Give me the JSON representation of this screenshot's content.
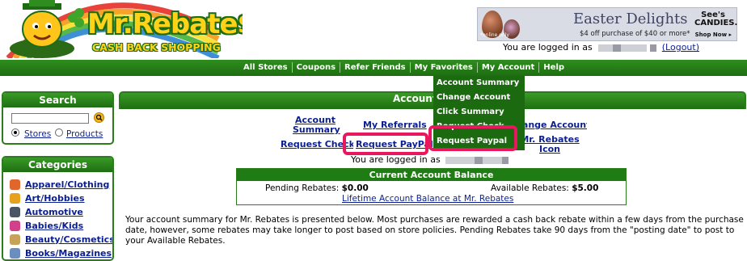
{
  "logo": {
    "title": "Mr.Rebate$",
    "subtitle": "CASH BACK SHOPPING"
  },
  "ad": {
    "headline": "Easter Delights",
    "offer": "$4 off purchase of $40 or more*",
    "fine_print": "*online only",
    "brand": "See's CANDIES.",
    "cta": "Shop Now ▸"
  },
  "header": {
    "logged_in_prefix": "You are logged in as",
    "logout_label": "(Logout)"
  },
  "nav": {
    "items": [
      "All Stores",
      "Coupons",
      "Refer Friends",
      "My Favorites",
      "My Account",
      "Help"
    ]
  },
  "dropdown": {
    "items": [
      "Account Summary",
      "Change Account",
      "Click Summary",
      "Request Check",
      "Request Paypal"
    ]
  },
  "search": {
    "title": "Search",
    "radio_stores": "Stores",
    "radio_products": "Products",
    "selected": "Stores"
  },
  "categories": {
    "title": "Categories",
    "items": [
      {
        "label": "Apparel/Clothing",
        "color": "#e0662b"
      },
      {
        "label": "Art/Hobbies",
        "color": "#e7a21d"
      },
      {
        "label": "Automotive",
        "color": "#4b5566"
      },
      {
        "label": "Babies/Kids",
        "color": "#d23f8a"
      },
      {
        "label": "Beauty/Cosmetics",
        "color": "#c8a25a"
      },
      {
        "label": "Books/Magazines",
        "color": "#6a8fbf"
      }
    ]
  },
  "main": {
    "title": "Account Summary",
    "links": {
      "account_summary_1": "Account",
      "account_summary_2": "Summary",
      "my_referrals": "My Referrals",
      "request_check": "Request Check",
      "request_paypal": "Request PayPal",
      "change_account": "Change Account",
      "rebates_icon_1": "Mr. Rebates",
      "rebates_icon_2": "Icon"
    },
    "logged_in_prefix": "You are logged in as"
  },
  "balance": {
    "title": "Current Account Balance",
    "pending_label": "Pending Rebates:",
    "pending_value": "$0.00",
    "available_label": "Available Rebates:",
    "available_value": "$5.00",
    "lifetime_link": "Lifetime Account Balance at Mr. Rebates"
  },
  "summary_text": "Your account summary for Mr. Rebates is presented below.  Most purchases are rewarded a cash back rebate within a few days from the purchase date, however, some rebates may take longer to post based on store policies.  Pending Rebates take 90 days from the \"posting date\" to post to your Available Rebates.",
  "colors": {
    "nav_green": "#1e6e11",
    "highlight": "#e9185e",
    "link": "#0b1f8f",
    "logo_yellow": "#ffd21a"
  }
}
